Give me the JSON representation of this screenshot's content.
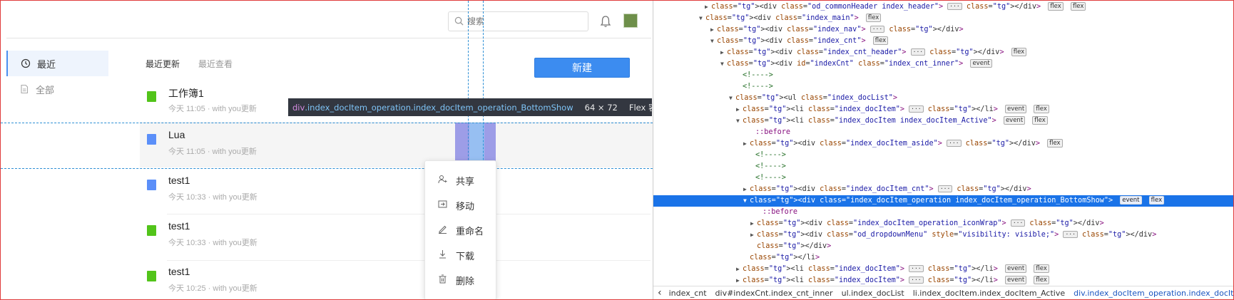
{
  "search": {
    "placeholder": "搜索"
  },
  "sidebar": {
    "items": [
      {
        "label": "最近",
        "icon": "clock-icon"
      },
      {
        "label": "全部",
        "icon": "doc-icon"
      }
    ]
  },
  "tabs": [
    "最近更新",
    "最近查看"
  ],
  "new_button": "新建",
  "docs": [
    {
      "name": "工作簿1",
      "meta": "今天 11:05  ·  with you更新",
      "icon": "sheet-icon",
      "color": "#52c41a"
    },
    {
      "name": "Lua",
      "meta": "今天 11:05  ·  with you更新",
      "icon": "doc-icon",
      "color": "#5b8ff9"
    },
    {
      "name": "test1",
      "meta": "今天 10:33  ·  with you更新",
      "icon": "doc-icon",
      "color": "#5b8ff9"
    },
    {
      "name": "test1",
      "meta": "今天 10:33  ·  with you更新",
      "icon": "sheet-icon",
      "color": "#52c41a"
    },
    {
      "name": "test1",
      "meta": "今天 10:25  ·  with you更新",
      "icon": "sheet-icon",
      "color": "#52c41a"
    }
  ],
  "tooltip": {
    "selector_tag": "div",
    "selector_class": ".index_docItem_operation.index_docItem_operation_BottomShow",
    "size": "64 × 72",
    "kind": "Flex 容器/项目"
  },
  "menu": [
    {
      "label": "共享",
      "icon": "share-icon"
    },
    {
      "label": "移动",
      "icon": "move-icon"
    },
    {
      "label": "重命名",
      "icon": "rename-icon"
    },
    {
      "label": "下载",
      "icon": "download-icon"
    },
    {
      "label": "删除",
      "icon": "delete-icon"
    }
  ],
  "devtools": {
    "lines": [
      "<div class=\"od_commonHeader index_header\"> … </div>",
      "<div class=\"index_main\">",
      "<div class=\"index_nav\"> … </div>",
      "<div class=\"index_cnt\">",
      "<div class=\"index_cnt_header\"> … </div>",
      "<div id=\"indexCnt\" class=\"index_cnt_inner\">",
      "<!---->",
      "<!---->",
      "<ul class=\"index_docList\">",
      "<li class=\"index_docItem\"> … </li>",
      "<li class=\"index_docItem index_docItem_Active\">",
      "::before",
      "<div class=\"index_docItem_aside\"> … </div>",
      "<!---->",
      "<!---->",
      "<!---->",
      "<div class=\"index_docItem_cnt\"> … </div>",
      "<div class=\"index_docItem_operation index_docItem_operation_BottomShow\">",
      "::before",
      "<div class=\"index_docItem_operation_iconWrap\"> … </div>",
      "<div class=\"od_dropdownMenu\" style=\"visibility: visible;\"> … </div>",
      "</div>",
      "</li>",
      "<li class=\"index_docItem\"> … </li>",
      "<li class=\"index_docItem\"> … </li>"
    ],
    "badges": {
      "flex": "flex",
      "event": "event"
    },
    "breadcrumbs": [
      "index_cnt",
      "div#indexCnt.index_cnt_inner",
      "ul.index_docList",
      "li.index_docItem.index_docItem_Active",
      "div.index_docItem_operation.index_docIte…"
    ]
  }
}
